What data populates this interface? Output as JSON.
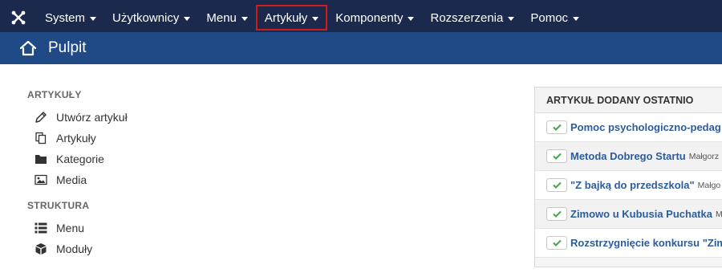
{
  "topnav": {
    "items": [
      {
        "label": "System"
      },
      {
        "label": "Użytkownicy"
      },
      {
        "label": "Menu"
      },
      {
        "label": "Artykuły"
      },
      {
        "label": "Komponenty"
      },
      {
        "label": "Rozszerzenia"
      },
      {
        "label": "Pomoc"
      }
    ],
    "active_index": 3
  },
  "header": {
    "title": "Pulpit"
  },
  "sidebar": {
    "sections": [
      {
        "heading": "ARTYKUŁY",
        "items": [
          {
            "label": "Utwórz artykuł",
            "icon": "pencil-icon"
          },
          {
            "label": "Artykuły",
            "icon": "copy-icon"
          },
          {
            "label": "Kategorie",
            "icon": "folder-icon"
          },
          {
            "label": "Media",
            "icon": "image-icon"
          }
        ]
      },
      {
        "heading": "STRUKTURA",
        "items": [
          {
            "label": "Menu",
            "icon": "list-icon"
          },
          {
            "label": "Moduły",
            "icon": "cube-icon"
          }
        ]
      }
    ]
  },
  "recent_panel": {
    "heading": "ARTYKUŁ DODANY OSTATNIO",
    "rows": [
      {
        "title": "Pomoc psychologiczno-pedag",
        "author": ""
      },
      {
        "title": "Metoda Dobrego Startu",
        "author": "Małgorz"
      },
      {
        "title": "\"Z bajką do przedszkola\"",
        "author": "Małgo"
      },
      {
        "title": "Zimowo u Kubusia Puchatka",
        "author": "M"
      },
      {
        "title": "Rozstrzygnięcie konkursu \"Zim",
        "author": ""
      }
    ]
  },
  "colors": {
    "topbar": "#1b2a4c",
    "titlebar": "#1f4a86",
    "link": "#2c5c9c",
    "check": "#46a546",
    "highlight": "#d31919"
  }
}
